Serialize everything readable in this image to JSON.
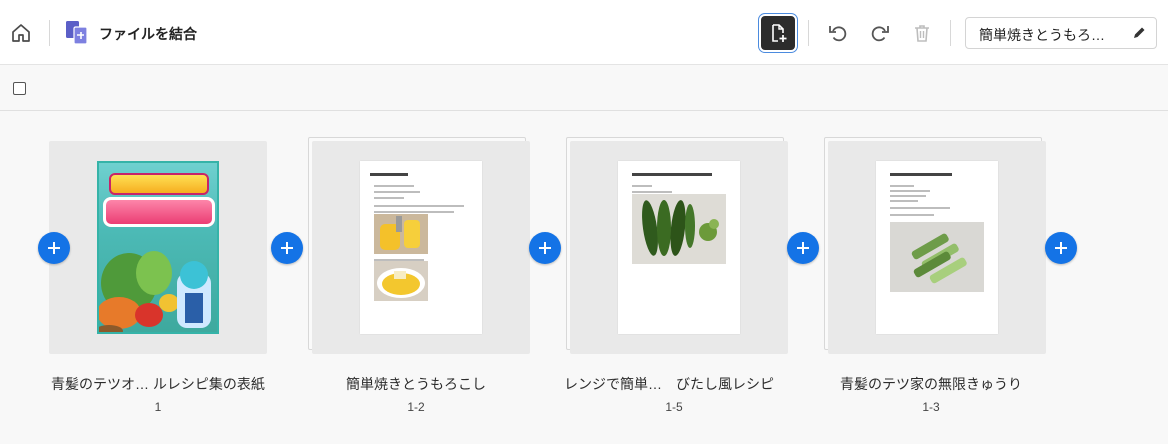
{
  "app": {
    "title": "ファイルを結合"
  },
  "toolbar": {
    "icons": [
      "home-icon",
      "combine-files-icon",
      "add-file-icon",
      "undo-icon",
      "redo-icon",
      "trash-icon",
      "pencil-icon"
    ],
    "filename": "簡単焼きとうもろ…",
    "accent": "#1473e6"
  },
  "files": [
    {
      "label": "青髪のテツオ… ルレシピ集の表紙",
      "pages": "1"
    },
    {
      "label": "簡単焼きとうもろこし",
      "pages": "1-2"
    },
    {
      "label": "レンジで簡単…　びたし風レシピ",
      "pages": "1-5"
    },
    {
      "label": "青髪のテツ家の無限きゅうり",
      "pages": "1-3"
    }
  ]
}
